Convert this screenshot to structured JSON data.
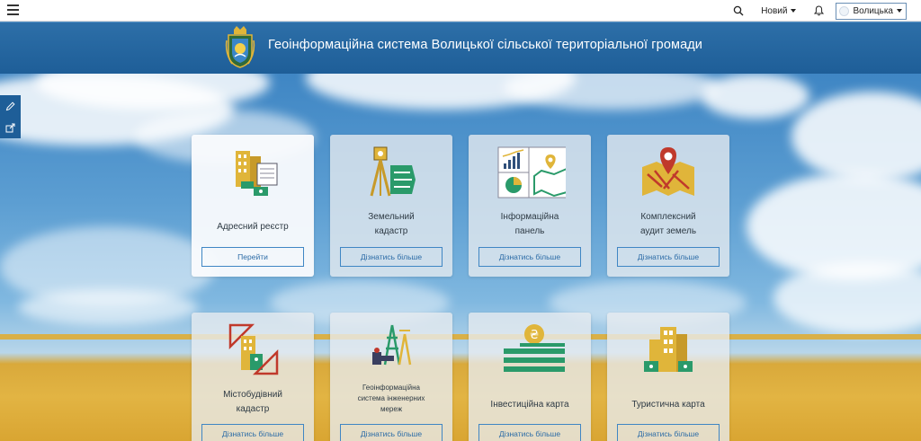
{
  "topbar": {
    "menu_icon": "hamburger-icon",
    "search_icon": "search-icon",
    "new_label": "Новий",
    "notifications_icon": "bell-icon",
    "user_label": "Волицька"
  },
  "header": {
    "title": "Геоінформаційна система Волицької сільської територіальної громади",
    "emblem_icon": "coat-of-arms-emblem"
  },
  "sidetools": [
    "pencil-icon",
    "share-icon"
  ],
  "cards_row1": [
    {
      "title_lines": [
        "Адресний реєстр"
      ],
      "button": "Перейти",
      "icon": "address-register-icon"
    },
    {
      "title_lines": [
        "Земельний",
        "кадастр"
      ],
      "button": "Дізнатись більше",
      "icon": "land-cadastre-icon"
    },
    {
      "title_lines": [
        "Інформаційна",
        "панель"
      ],
      "button": "Дізнатись більше",
      "icon": "dashboard-icon"
    },
    {
      "title_lines": [
        "Комплексний",
        "аудит земель"
      ],
      "button": "Дізнатись більше",
      "icon": "land-audit-map-icon"
    }
  ],
  "cards_row2": [
    {
      "title_lines": [
        "Містобудівний",
        "кадастр"
      ],
      "button": "Дізнатись більше",
      "icon": "urban-cadastre-icon"
    },
    {
      "title_lines": [
        "Геоінформаційна",
        "система інженерних",
        "мереж"
      ],
      "button": "Дізнатись більше",
      "icon": "engineering-networks-icon"
    },
    {
      "title_lines": [
        "Інвестиційна карта"
      ],
      "button": "Дізнатись більше",
      "icon": "investment-map-icon"
    },
    {
      "title_lines": [
        "Туристична карта"
      ],
      "button": "Дізнатись більше",
      "icon": "tourist-map-icon"
    }
  ],
  "colors": {
    "header_blue": "#1e5e98",
    "accent_blue": "#3f86c4",
    "icon_gold": "#e0b53a",
    "icon_green": "#2a9a6a",
    "icon_red": "#c0392b"
  }
}
